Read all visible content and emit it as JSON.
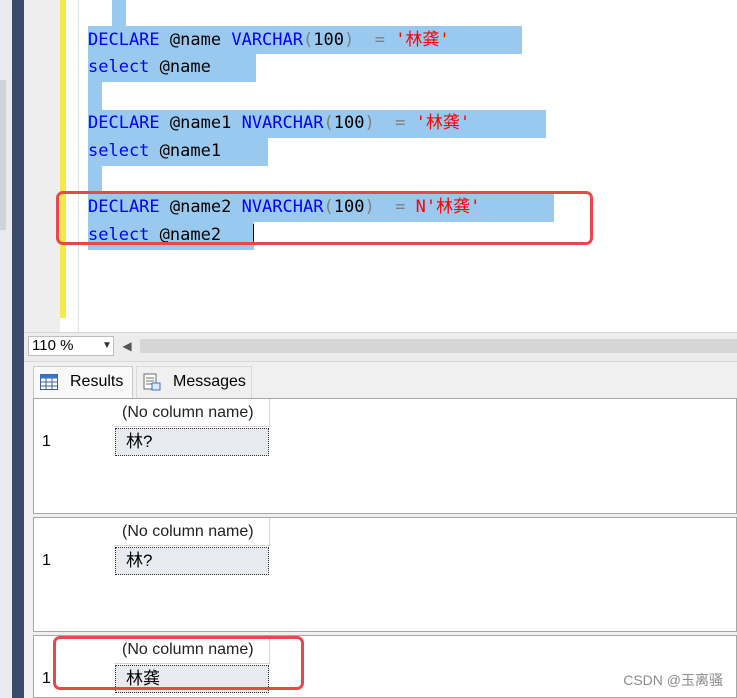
{
  "editor": {
    "lines": [
      {
        "keyword": "DECLARE",
        "var": "@name",
        "type": "VARCHAR",
        "open": "(",
        "size": "100",
        "close": ")",
        "eq": "  =",
        "prefix": "",
        "value": "'林龚'"
      },
      {
        "keyword": "DECLARE",
        "var": "@name1",
        "type": "NVARCHAR",
        "open": "(",
        "size": "100",
        "close": ")",
        "eq": "  =",
        "prefix": "",
        "value": "'林龚'"
      },
      {
        "keyword": "DECLARE",
        "var": "@name2",
        "type": "NVARCHAR",
        "open": "(",
        "size": "100",
        "close": ")",
        "eq": "  =",
        "prefix": "N",
        "value": "'林龚'"
      }
    ],
    "selects": [
      {
        "keyword": "select",
        "var": "@name"
      },
      {
        "keyword": "select",
        "var": "@name1"
      },
      {
        "keyword": "select",
        "var": "@name2"
      }
    ]
  },
  "zoom": {
    "value": "110 %"
  },
  "tabs": {
    "results": "Results",
    "messages": "Messages"
  },
  "results": [
    {
      "header": "(No column name)",
      "row": "1",
      "value": "林?"
    },
    {
      "header": "(No column name)",
      "row": "1",
      "value": "林?"
    },
    {
      "header": "(No column name)",
      "row": "1",
      "value": "林龚"
    }
  ],
  "watermark": "CSDN @玉离骚",
  "colors": {
    "keyword": "#0000ff",
    "string": "#ff0000",
    "selection": "#99c9ef",
    "annotation": "#e8484a"
  }
}
